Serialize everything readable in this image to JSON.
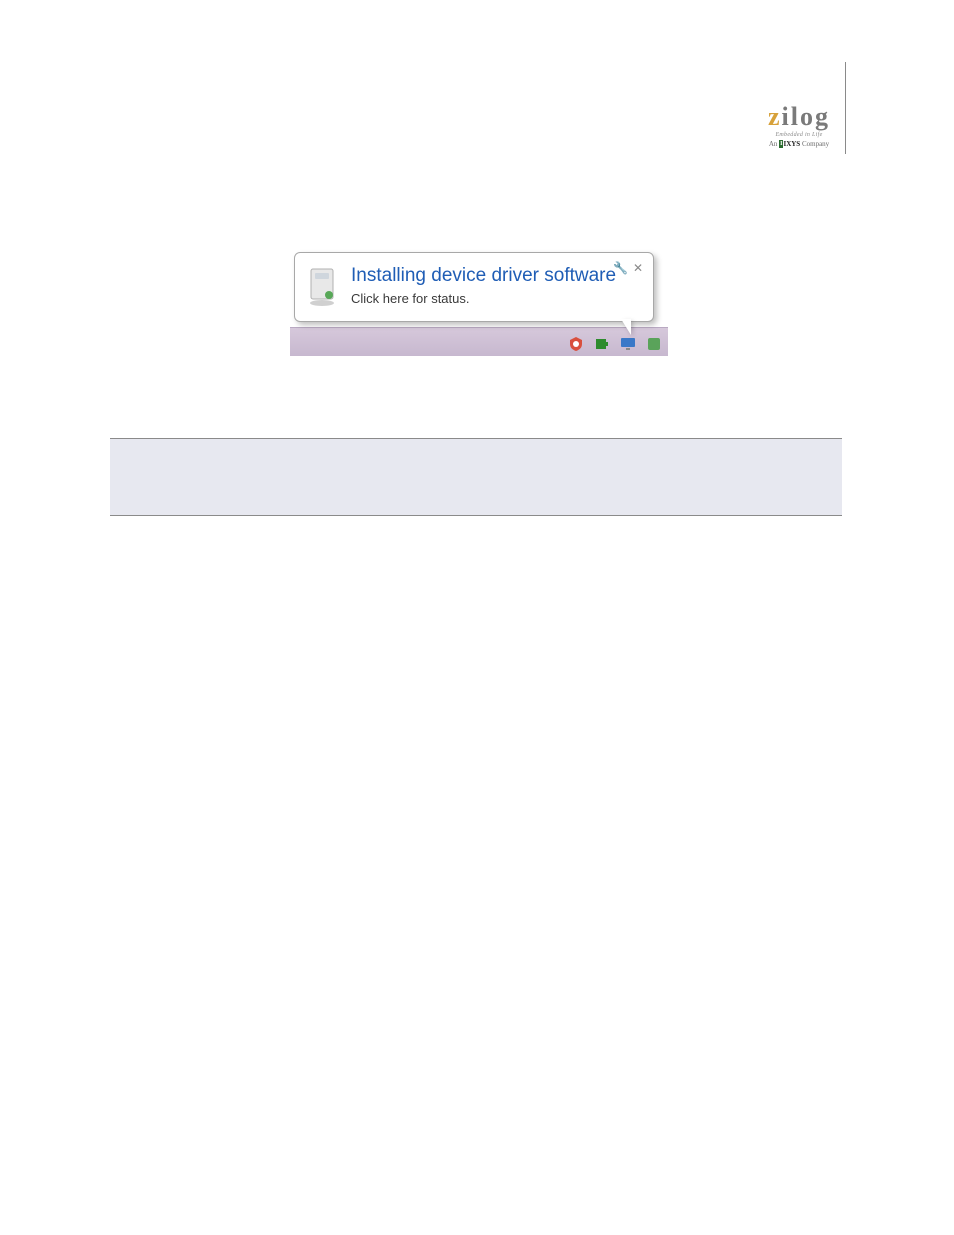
{
  "logo": {
    "z": "z",
    "rest": "ilog",
    "tagline": "Embedded in Life",
    "company_prefix": "An ",
    "company_ixys_mark": "I",
    "company_ixys": "IXYS",
    "company_suffix": " Company"
  },
  "balloon": {
    "title": "Installing device driver software",
    "subtitle": "Click here for status.",
    "wrench_glyph": "🔧",
    "close_glyph": "✕"
  },
  "tray": {
    "icons": [
      "security-icon",
      "battery-icon",
      "display-icon",
      "unknown-icon"
    ]
  }
}
